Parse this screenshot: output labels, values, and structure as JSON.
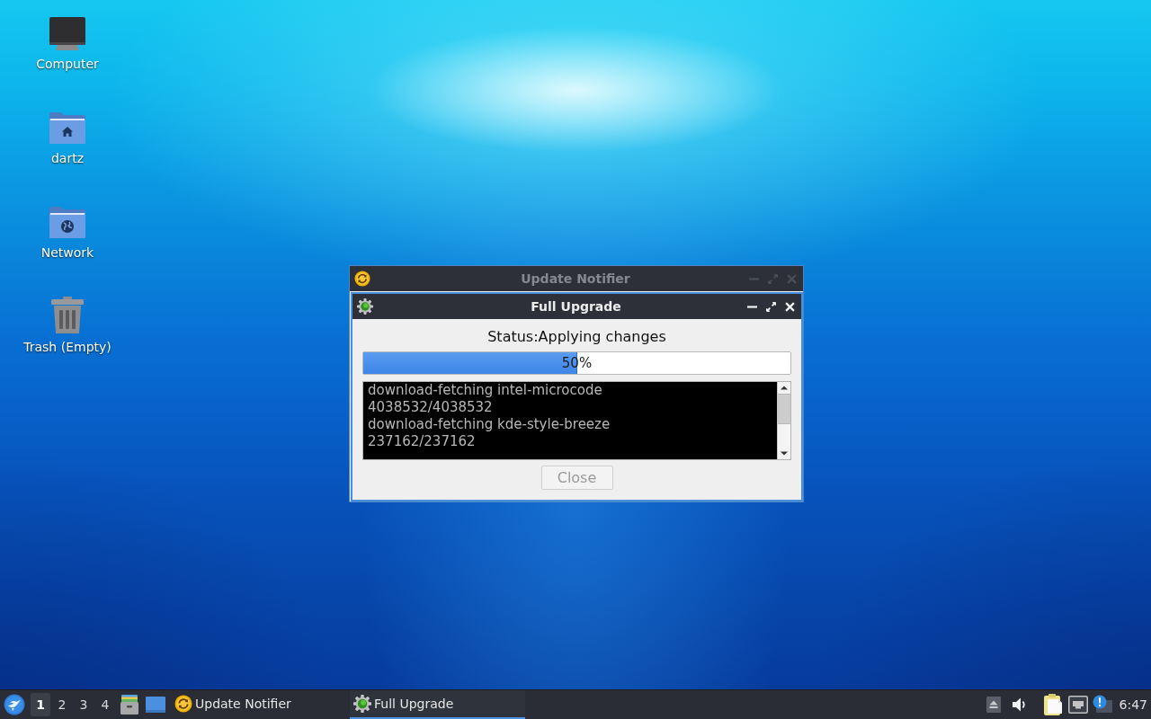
{
  "desktop_icons": [
    {
      "label": "Computer",
      "kind": "computer"
    },
    {
      "label": "dartz",
      "kind": "home"
    },
    {
      "label": "Network",
      "kind": "network"
    },
    {
      "label": "Trash (Empty)",
      "kind": "trash"
    }
  ],
  "background_window": {
    "title": "Update Notifier",
    "active": false
  },
  "dialog": {
    "title": "Full Upgrade",
    "active": true,
    "status": "Status:Applying changes",
    "progress": {
      "level": 0.5,
      "reading": "50%"
    },
    "log": [
      "download-fetching intel-microcode",
      "4038532/4038532",
      "download-fetching kde-style-breeze",
      "237162/237162"
    ],
    "close_button": {
      "label": "Close",
      "disabled": true
    }
  },
  "taskbar": {
    "workspaces": [
      {
        "label": "1",
        "selected": true
      },
      {
        "label": "2",
        "selected": false
      },
      {
        "label": "3",
        "selected": false
      },
      {
        "label": "4",
        "selected": false
      }
    ],
    "tasks": [
      {
        "label": "Update Notifier",
        "kind": "notifier",
        "selected": false
      },
      {
        "label": "Full Upgrade",
        "kind": "upgrade",
        "selected": true
      }
    ],
    "clock": "6:47"
  }
}
